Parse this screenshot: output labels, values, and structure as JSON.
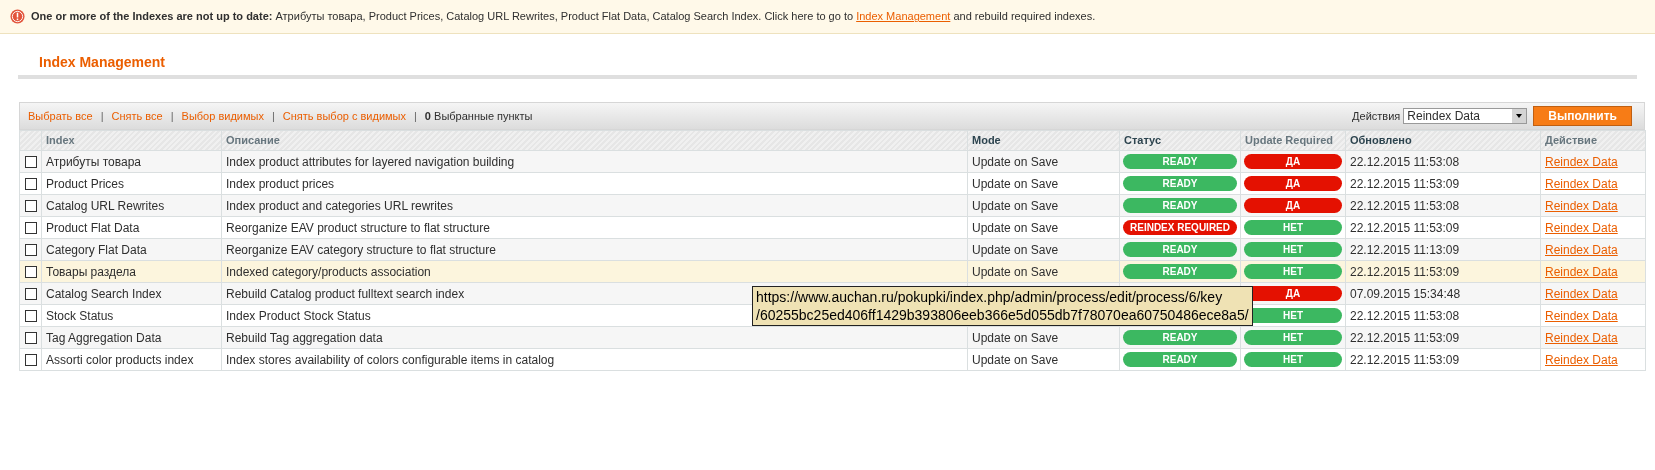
{
  "notice": {
    "lead": "One or more of the Indexes are not up to date:",
    "text": "Атрибуты товара, Product Prices, Catalog URL Rewrites, Product Flat Data, Catalog Search Index. Click here to go to",
    "link": "Index Management",
    "tail": "and rebuild required indexes."
  },
  "page_title": "Index Management",
  "massaction": {
    "separator": "|",
    "links": [
      "Выбрать все",
      "Снять все",
      "Выбор видимых",
      "Снять выбор с видимых"
    ],
    "count": "0",
    "count_label": "Выбранные пункты",
    "actions_label": "Действия",
    "action_value": "Reindex Data",
    "submit": "Выполнить"
  },
  "table": {
    "columns": [
      {
        "label": "Index",
        "sortable": true
      },
      {
        "label": "Описание",
        "sortable": true
      },
      {
        "label": "Mode",
        "sortable": false
      },
      {
        "label": "Статус",
        "sortable": false
      },
      {
        "label": "Update Required",
        "sortable": true
      },
      {
        "label": "Обновлено",
        "sortable": false
      },
      {
        "label": "Действие",
        "sortable": true
      }
    ],
    "rows": [
      {
        "checked": false,
        "highlighted": false,
        "index": "Атрибуты товара",
        "description": "Index product attributes for layered navigation building",
        "mode": "Update on Save",
        "status": {
          "kind": "ready",
          "label": "READY"
        },
        "update_required": {
          "kind": "yes",
          "label": "ДА"
        },
        "updated": "22.12.2015 11:53:08",
        "action": "Reindex Data"
      },
      {
        "checked": false,
        "highlighted": false,
        "index": "Product Prices",
        "description": "Index product prices",
        "mode": "Update on Save",
        "status": {
          "kind": "ready",
          "label": "READY"
        },
        "update_required": {
          "kind": "yes",
          "label": "ДА"
        },
        "updated": "22.12.2015 11:53:09",
        "action": "Reindex Data"
      },
      {
        "checked": false,
        "highlighted": false,
        "index": "Catalog URL Rewrites",
        "description": "Index product and categories URL rewrites",
        "mode": "Update on Save",
        "status": {
          "kind": "ready",
          "label": "READY"
        },
        "update_required": {
          "kind": "yes",
          "label": "ДА"
        },
        "updated": "22.12.2015 11:53:08",
        "action": "Reindex Data"
      },
      {
        "checked": false,
        "highlighted": false,
        "index": "Product Flat Data",
        "description": "Reorganize EAV product structure to flat structure",
        "mode": "Update on Save",
        "status": {
          "kind": "required",
          "label": "REINDEX REQUIRED"
        },
        "update_required": {
          "kind": "no",
          "label": "НЕТ"
        },
        "updated": "22.12.2015 11:53:09",
        "action": "Reindex Data"
      },
      {
        "checked": false,
        "highlighted": false,
        "index": "Category Flat Data",
        "description": "Reorganize EAV category structure to flat structure",
        "mode": "Update on Save",
        "status": {
          "kind": "ready",
          "label": "READY"
        },
        "update_required": {
          "kind": "no",
          "label": "НЕТ"
        },
        "updated": "22.12.2015 11:13:09",
        "action": "Reindex Data"
      },
      {
        "checked": false,
        "highlighted": true,
        "index": "Товары раздела",
        "description": "Indexed category/products association",
        "mode": "Update on Save",
        "status": {
          "kind": "ready",
          "label": "READY"
        },
        "update_required": {
          "kind": "no",
          "label": "НЕТ"
        },
        "updated": "22.12.2015 11:53:09",
        "action": "Reindex Data"
      },
      {
        "checked": false,
        "highlighted": false,
        "index": "Catalog Search Index",
        "description": "Rebuild Catalog product fulltext search index",
        "update_required": {
          "kind": "yes",
          "label": "ДА"
        },
        "updated": "07.09.2015 15:34:48",
        "action": "Reindex Data"
      },
      {
        "checked": false,
        "highlighted": false,
        "index": "Stock Status",
        "description": "Index Product Stock Status",
        "update_required": {
          "kind": "no",
          "label": "НЕТ"
        },
        "updated": "22.12.2015 11:53:08",
        "action": "Reindex Data"
      },
      {
        "checked": false,
        "highlighted": false,
        "index": "Tag Aggregation Data",
        "description": "Rebuild Tag aggregation data",
        "mode": "Update on Save",
        "status": {
          "kind": "ready",
          "label": "READY"
        },
        "update_required": {
          "kind": "no",
          "label": "НЕТ"
        },
        "updated": "22.12.2015 11:53:09",
        "action": "Reindex Data"
      },
      {
        "checked": false,
        "highlighted": false,
        "index": "Assorti color products index",
        "description": "Index stores availability of colors configurable items in catalog",
        "mode": "Update on Save",
        "status": {
          "kind": "ready",
          "label": "READY"
        },
        "update_required": {
          "kind": "no",
          "label": "НЕТ"
        },
        "updated": "22.12.2015 11:53:09",
        "action": "Reindex Data"
      }
    ]
  },
  "tooltip": {
    "lines": [
      "https://www.auchan.ru/pokupki/index.php/admin/process/edit/process/6/key",
      "/60255bc25ed406ff1429b393806eeb366e5d055db7f78070ea60750486ece8a5/"
    ]
  }
}
